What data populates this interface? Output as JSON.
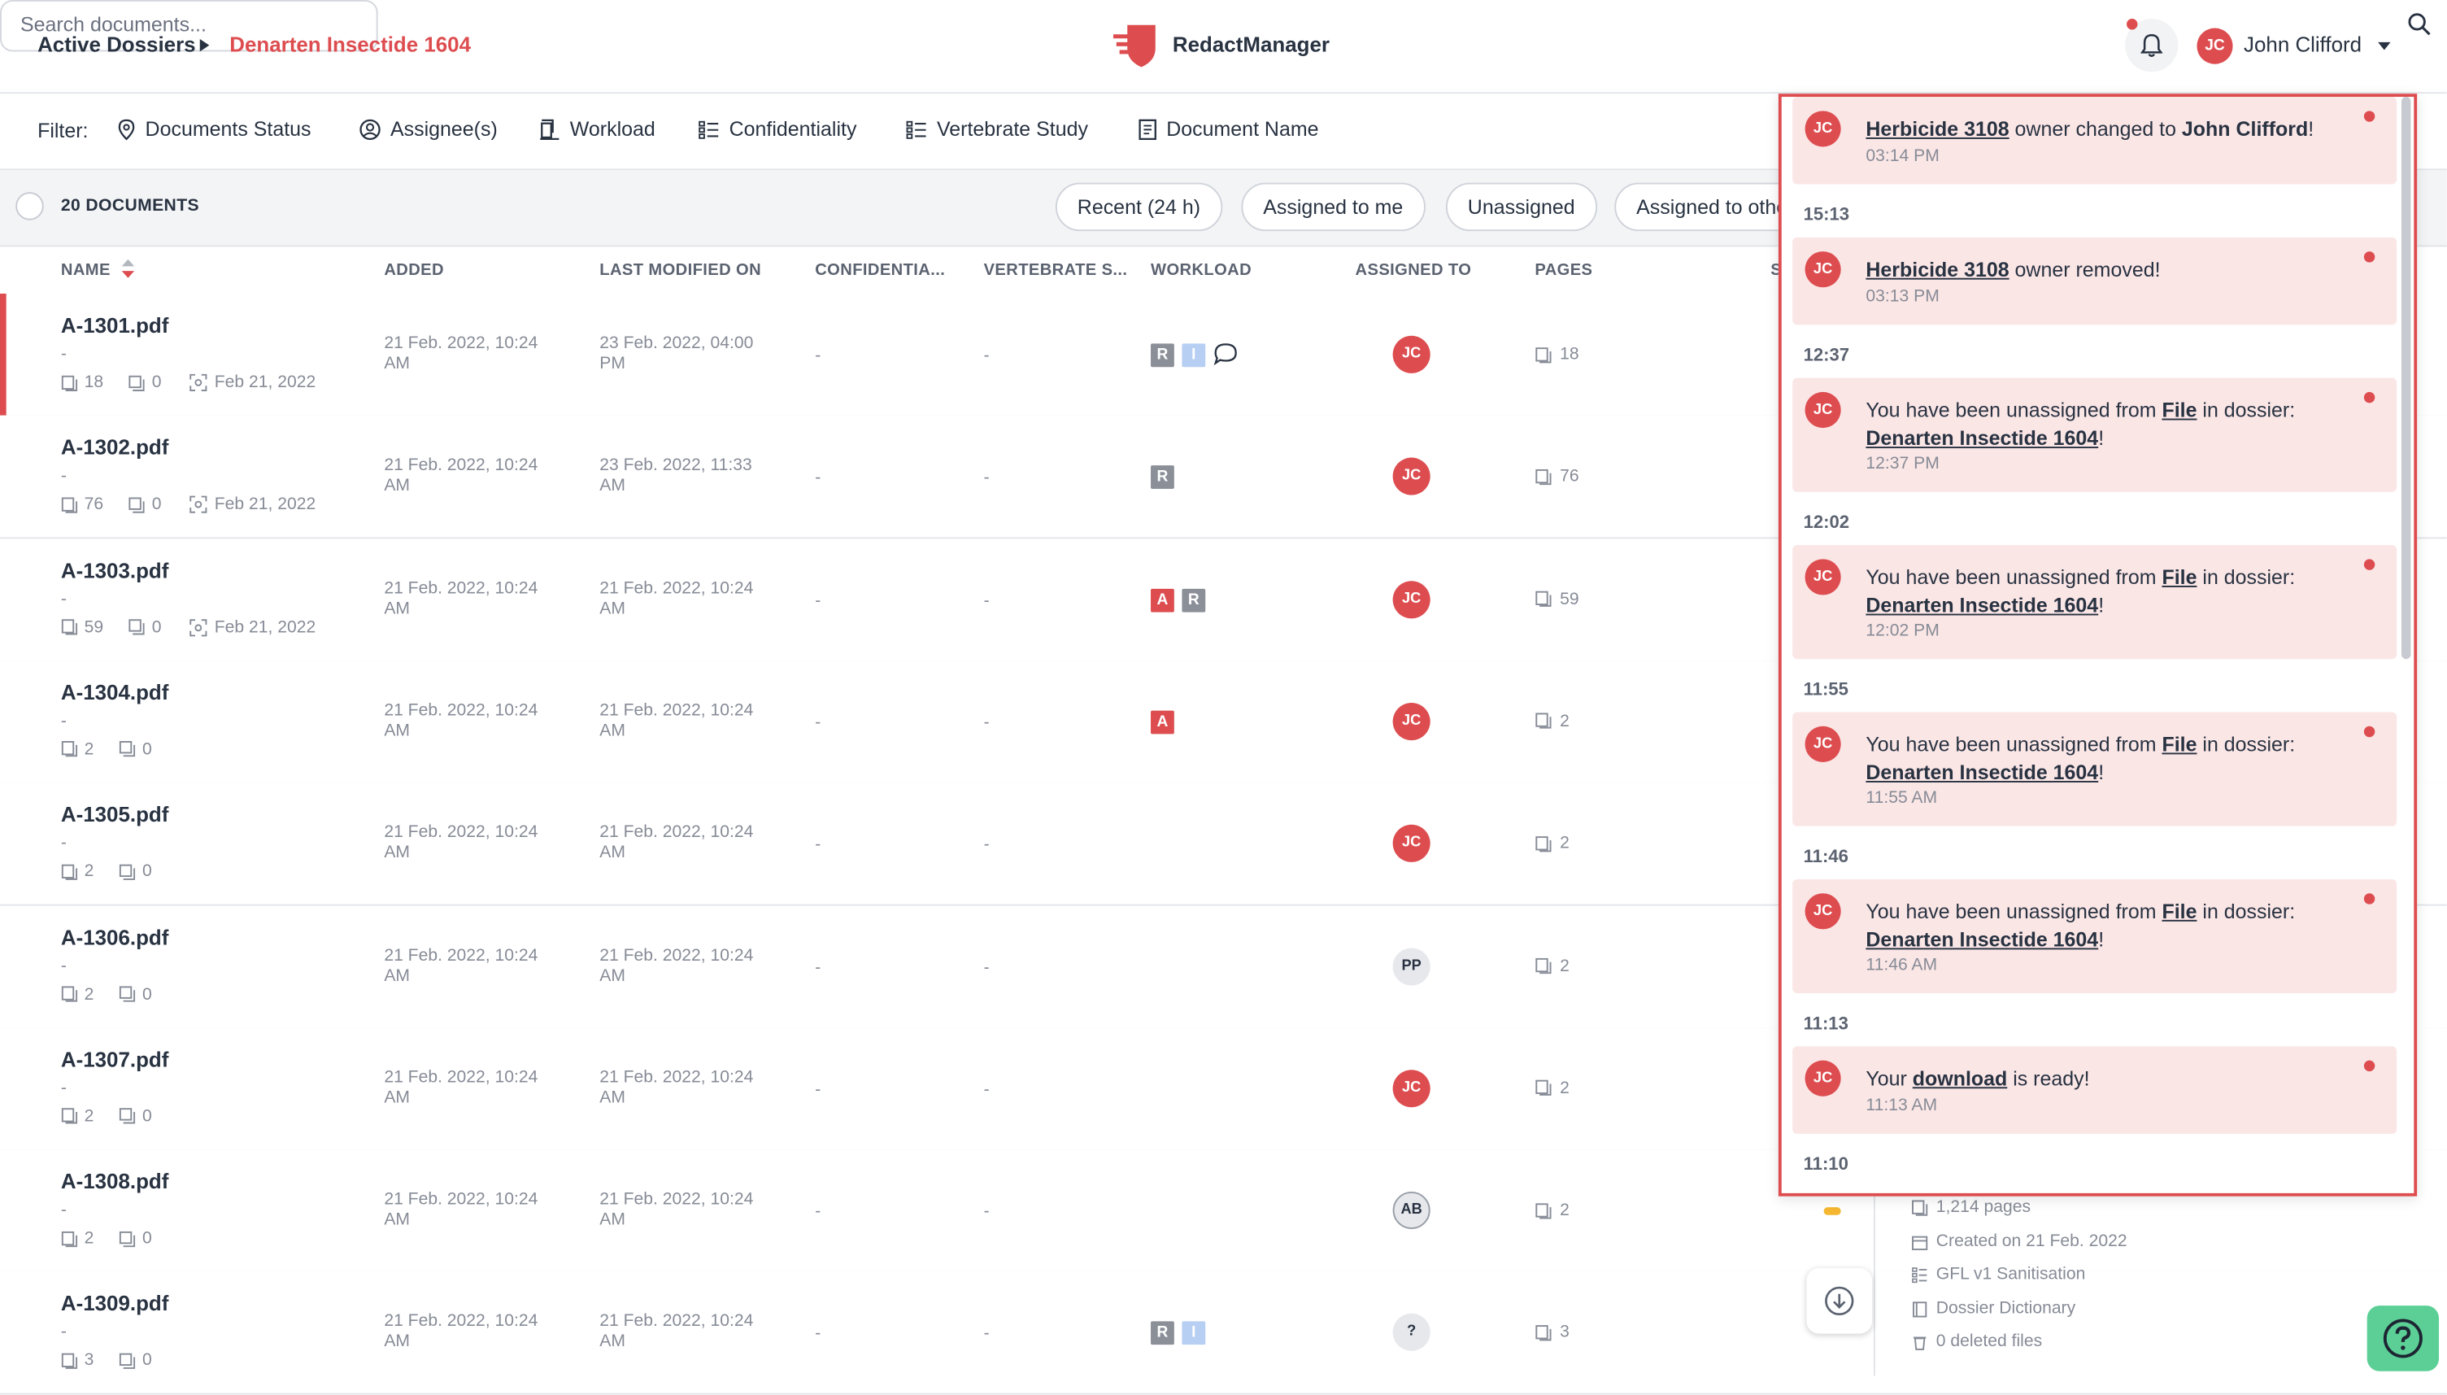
{
  "header": {
    "breadcrumb_root": "Active Dossiers",
    "breadcrumb_current": "Denarten Insectide 1604",
    "brand": "RedactManager",
    "search_placeholder": "Search documents...",
    "user_initials": "JC",
    "user_name": "John Clifford"
  },
  "filters": {
    "label": "Filter:",
    "items": [
      "Documents Status",
      "Assignee(s)",
      "Workload",
      "Confidentiality",
      "Vertebrate Study",
      "Document Name"
    ]
  },
  "docbar": {
    "count": "20 DOCUMENTS",
    "chips": [
      "Recent (24 h)",
      "Assigned to me",
      "Unassigned",
      "Assigned to others"
    ]
  },
  "columns": [
    "NAME",
    "ADDED",
    "LAST MODIFIED ON",
    "CONFIDENTIA...",
    "VERTEBRATE S...",
    "WORKLOAD",
    "ASSIGNED TO",
    "PAGES",
    "S"
  ],
  "rows": [
    {
      "name": "A-1301.pdf",
      "dash": "-",
      "pages_meta": "18",
      "comments": "0",
      "date": "Feb 21, 2022",
      "added_1": "21 Feb. 2022, 10:24",
      "added_2": "AM",
      "mod_1": "23 Feb. 2022, 04:00",
      "mod_2": "PM",
      "conf": "-",
      "vert": "-",
      "workload": [
        "R",
        "I",
        "chat"
      ],
      "assignee": "JC",
      "pages": "18"
    },
    {
      "name": "A-1302.pdf",
      "dash": "-",
      "pages_meta": "76",
      "comments": "0",
      "date": "Feb 21, 2022",
      "added_1": "21 Feb. 2022, 10:24",
      "added_2": "AM",
      "mod_1": "23 Feb. 2022, 11:33",
      "mod_2": "AM",
      "conf": "-",
      "vert": "-",
      "workload": [
        "R"
      ],
      "assignee": "JC",
      "pages": "76"
    },
    {
      "name": "A-1303.pdf",
      "dash": "-",
      "pages_meta": "59",
      "comments": "0",
      "date": "Feb 21, 2022",
      "added_1": "21 Feb. 2022, 10:24",
      "added_2": "AM",
      "mod_1": "21 Feb. 2022, 10:24",
      "mod_2": "AM",
      "conf": "-",
      "vert": "-",
      "workload": [
        "A",
        "R"
      ],
      "assignee": "JC",
      "pages": "59"
    },
    {
      "name": "A-1304.pdf",
      "dash": "-",
      "pages_meta": "2",
      "comments": "0",
      "date": "",
      "added_1": "21 Feb. 2022, 10:24",
      "added_2": "AM",
      "mod_1": "21 Feb. 2022, 10:24",
      "mod_2": "AM",
      "conf": "-",
      "vert": "-",
      "workload": [
        "A"
      ],
      "assignee": "JC",
      "pages": "2"
    },
    {
      "name": "A-1305.pdf",
      "dash": "-",
      "pages_meta": "2",
      "comments": "0",
      "date": "",
      "added_1": "21 Feb. 2022, 10:24",
      "added_2": "AM",
      "mod_1": "21 Feb. 2022, 10:24",
      "mod_2": "AM",
      "conf": "-",
      "vert": "-",
      "workload": [],
      "assignee": "JC",
      "pages": "2"
    },
    {
      "name": "A-1306.pdf",
      "dash": "-",
      "pages_meta": "2",
      "comments": "0",
      "date": "",
      "added_1": "21 Feb. 2022, 10:24",
      "added_2": "AM",
      "mod_1": "21 Feb. 2022, 10:24",
      "mod_2": "AM",
      "conf": "-",
      "vert": "-",
      "workload": [],
      "assignee": "PP",
      "pages": "2"
    },
    {
      "name": "A-1307.pdf",
      "dash": "-",
      "pages_meta": "2",
      "comments": "0",
      "date": "",
      "added_1": "21 Feb. 2022, 10:24",
      "added_2": "AM",
      "mod_1": "21 Feb. 2022, 10:24",
      "mod_2": "AM",
      "conf": "-",
      "vert": "-",
      "workload": [],
      "assignee": "JC",
      "pages": "2"
    },
    {
      "name": "A-1308.pdf",
      "dash": "-",
      "pages_meta": "2",
      "comments": "0",
      "date": "",
      "added_1": "21 Feb. 2022, 10:24",
      "added_2": "AM",
      "mod_1": "21 Feb. 2022, 10:24",
      "mod_2": "AM",
      "conf": "-",
      "vert": "-",
      "workload": [],
      "assignee": "AB",
      "pages": "2"
    },
    {
      "name": "A-1309.pdf",
      "dash": "-",
      "pages_meta": "3",
      "comments": "0",
      "date": "",
      "added_1": "21 Feb. 2022, 10:24",
      "added_2": "AM",
      "mod_1": "21 Feb. 2022, 10:24",
      "mod_2": "AM",
      "conf": "-",
      "vert": "-",
      "workload": [
        "R",
        "I"
      ],
      "assignee": "?",
      "pages": "3"
    }
  ],
  "side_panel": {
    "items": [
      "1,214 pages",
      "Created on 21 Feb. 2022",
      "GFL v1 Sanitisation",
      "Dossier Dictionary",
      "0 deleted files"
    ]
  },
  "notifications": {
    "groups": [
      {
        "time": "",
        "initials": "JC",
        "parts": [
          {
            "t": "Herbicide 3108",
            "u": true
          },
          {
            "t": " owner changed to "
          },
          {
            "t": "John Clifford",
            "b": true
          },
          {
            "t": "!"
          }
        ],
        "sub": "03:14 PM",
        "lines": 1
      },
      {
        "time": "15:13",
        "initials": "JC",
        "parts": [
          {
            "t": "Herbicide 3108",
            "u": true
          },
          {
            "t": " owner removed!"
          }
        ],
        "sub": "03:13 PM",
        "lines": 1
      },
      {
        "time": "12:37",
        "initials": "JC",
        "parts": [
          {
            "t": "You have been unassigned from "
          },
          {
            "t": "File",
            "u": true
          },
          {
            "t": " in dossier: "
          },
          {
            "t": "Denarten Insectide 1604",
            "u": true
          },
          {
            "t": "!"
          }
        ],
        "sub": "12:37 PM",
        "lines": 2
      },
      {
        "time": "12:02",
        "initials": "JC",
        "parts": [
          {
            "t": "You have been unassigned from "
          },
          {
            "t": "File",
            "u": true
          },
          {
            "t": " in dossier: "
          },
          {
            "t": "Denarten Insectide 1604",
            "u": true
          },
          {
            "t": "!"
          }
        ],
        "sub": "12:02 PM",
        "lines": 2
      },
      {
        "time": "11:55",
        "initials": "JC",
        "parts": [
          {
            "t": "You have been unassigned from "
          },
          {
            "t": "File",
            "u": true
          },
          {
            "t": " in dossier: "
          },
          {
            "t": "Denarten Insectide 1604",
            "u": true
          },
          {
            "t": "!"
          }
        ],
        "sub": "11:55 AM",
        "lines": 2
      },
      {
        "time": "11:46",
        "initials": "JC",
        "parts": [
          {
            "t": "You have been unassigned from "
          },
          {
            "t": "File",
            "u": true
          },
          {
            "t": " in dossier: "
          },
          {
            "t": "Denarten Insectide 1604",
            "u": true
          },
          {
            "t": "!"
          }
        ],
        "sub": "11:46 AM",
        "lines": 2
      },
      {
        "time": "11:13",
        "initials": "JC",
        "parts": [
          {
            "t": "Your "
          },
          {
            "t": "download",
            "u": true
          },
          {
            "t": " is ready!"
          }
        ],
        "sub": "11:13 AM",
        "lines": 1
      },
      {
        "time": "11:10",
        "initials": "",
        "parts": [],
        "sub": "",
        "lines": 0
      }
    ]
  },
  "colors": {
    "accent": "#dd4d50",
    "help": "#5bcf95",
    "workload_yellow": "#f5b731"
  }
}
